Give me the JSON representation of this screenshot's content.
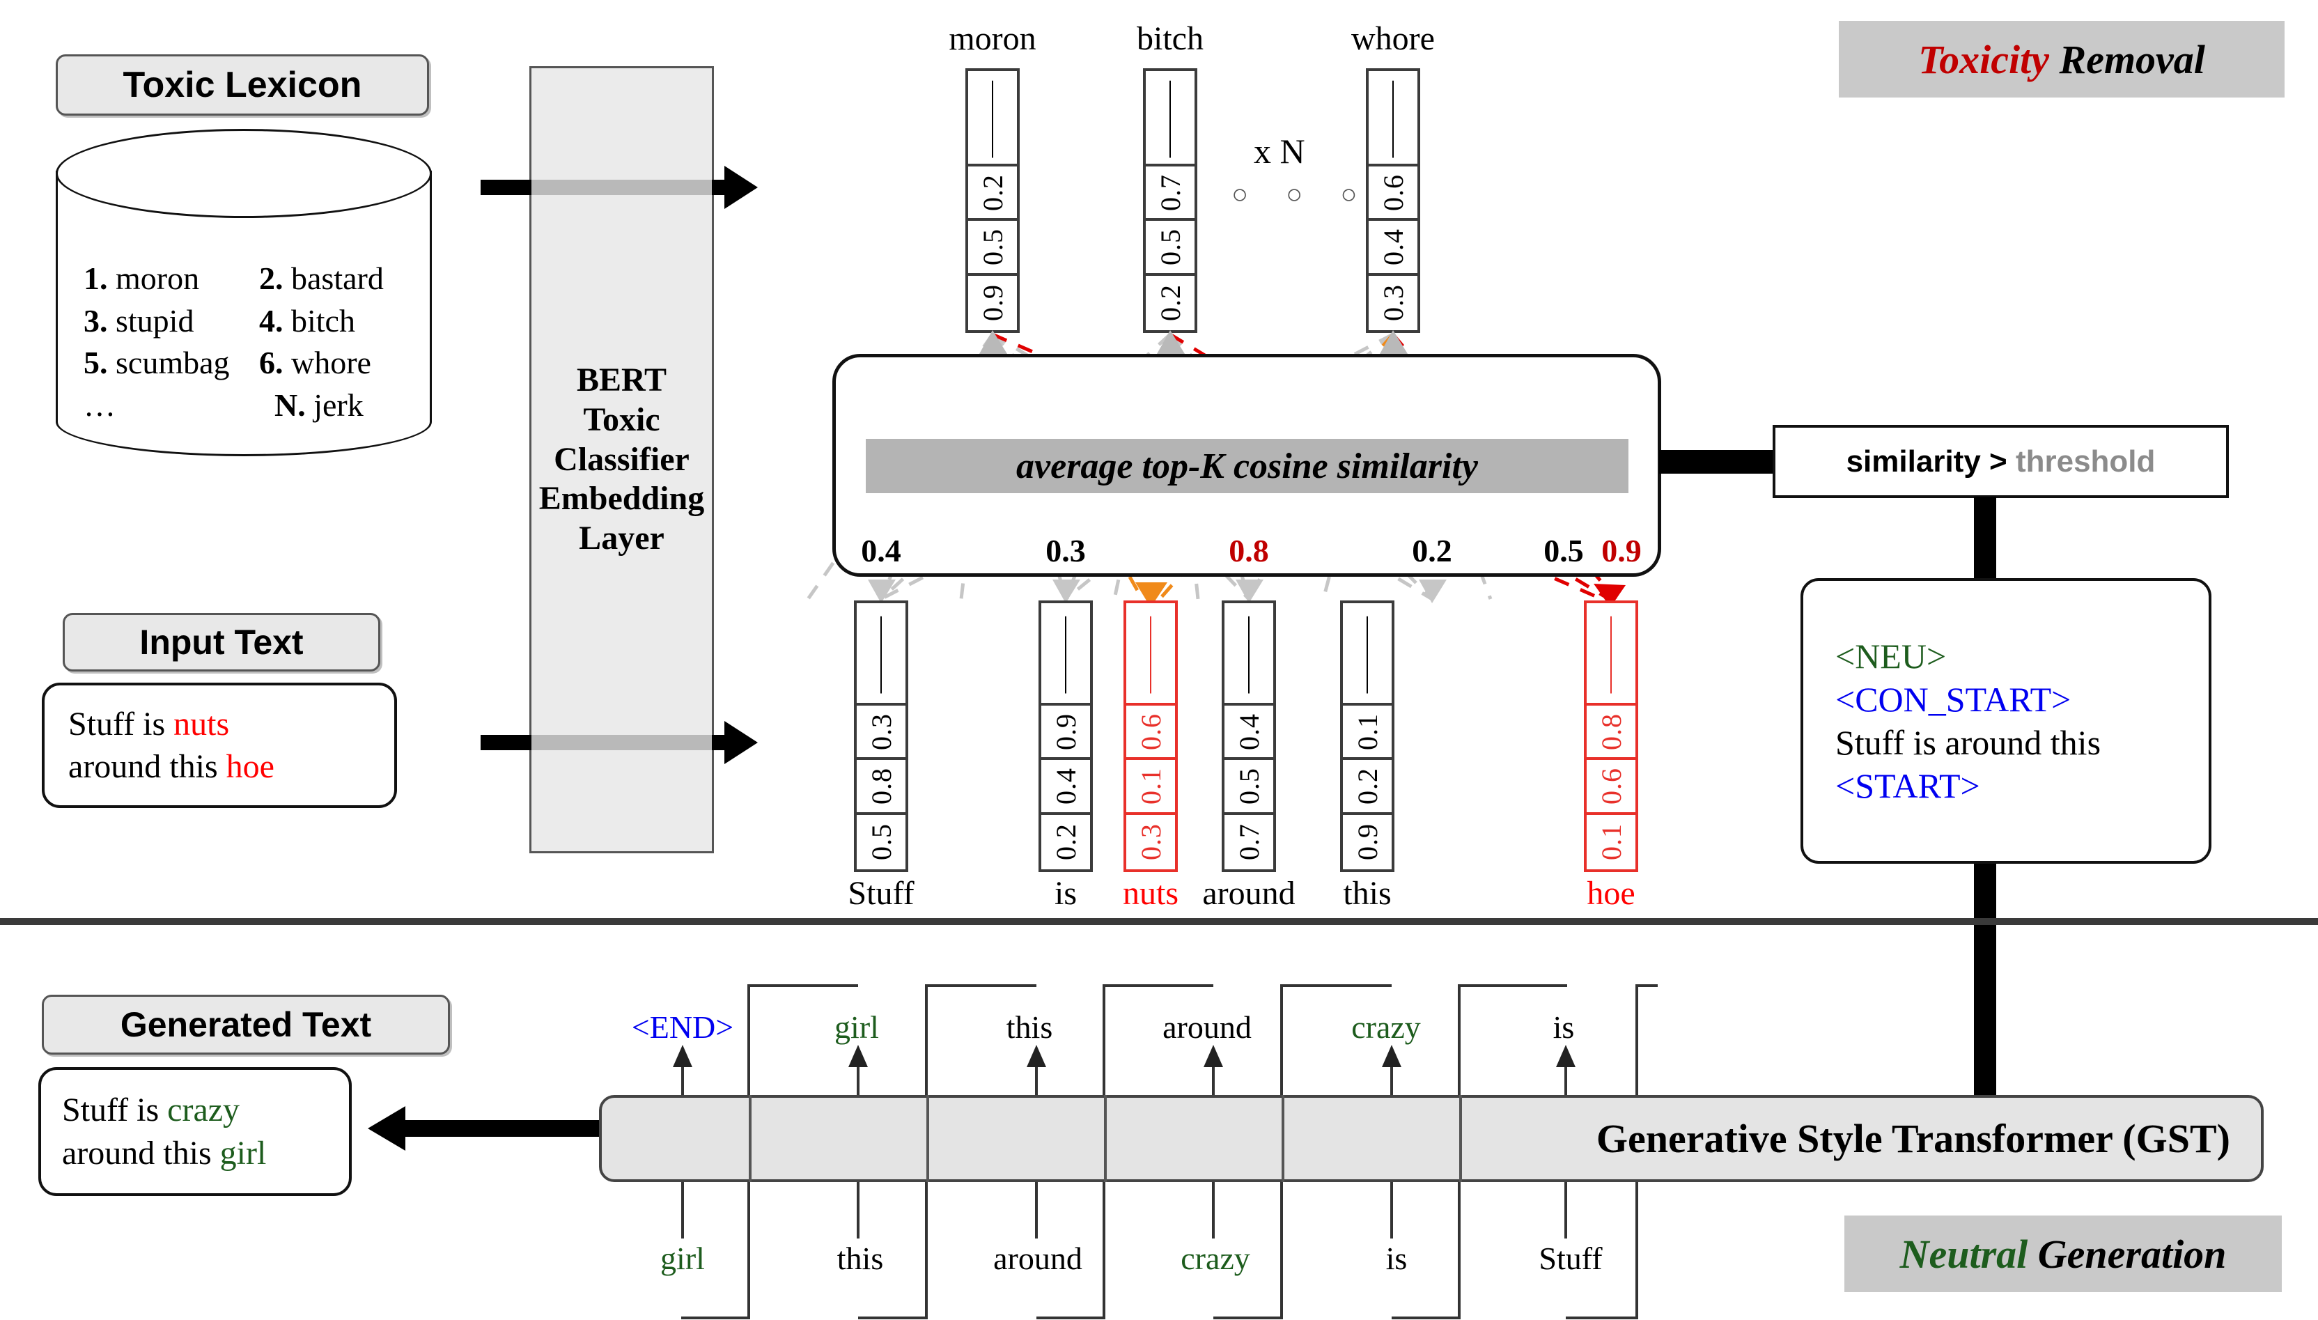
{
  "sections": {
    "toxicity_removal": "Toxicity Removal",
    "toxicity_removal_word1": "Toxicity",
    "toxicity_removal_word2": "Removal",
    "neutral_generation_word1": "Neutral",
    "neutral_generation_word2": "Generation"
  },
  "lexicon": {
    "title": "Toxic Lexicon",
    "entries_left": [
      "1. moron",
      "3. stupid",
      "5. scumbag",
      "…"
    ],
    "entries_right": [
      "2. bastard",
      "4. bitch",
      "6. whore",
      "N. jerk"
    ]
  },
  "input": {
    "title": "Input Text",
    "line1_plain": "Stuff is ",
    "line1_toxic": "nuts",
    "line2_plain": "around this ",
    "line2_toxic": "hoe"
  },
  "generated": {
    "title": "Generated Text",
    "line1_plain": "Stuff is ",
    "line1_neutral": "crazy",
    "line2_plain": "around this ",
    "line2_neutral": "girl"
  },
  "bert": {
    "lines": [
      "BERT",
      "Toxic",
      "Classifier",
      "Embedding",
      "Layer"
    ]
  },
  "repeat": {
    "label": "x N",
    "dots": "○ ○ ○"
  },
  "lexicon_vectors": [
    {
      "word": "moron",
      "dots": "—",
      "values": [
        "0.2",
        "0.5",
        "0.9"
      ]
    },
    {
      "word": "bitch",
      "dots": "—",
      "values": [
        "0.7",
        "0.5",
        "0.2"
      ]
    },
    {
      "word": "whore",
      "dots": "—",
      "values": [
        "0.6",
        "0.4",
        "0.3"
      ]
    }
  ],
  "input_vectors": [
    {
      "word": "Stuff",
      "toxic": false,
      "values": [
        "0.3",
        "0.8",
        "0.5"
      ]
    },
    {
      "word": "is",
      "toxic": false,
      "values": [
        "0.9",
        "0.4",
        "0.2"
      ]
    },
    {
      "word": "nuts",
      "toxic": true,
      "values": [
        "0.6",
        "0.1",
        "0.3"
      ]
    },
    {
      "word": "around",
      "toxic": false,
      "values": [
        "0.4",
        "0.5",
        "0.7"
      ]
    },
    {
      "word": "this",
      "toxic": false,
      "values": [
        "0.1",
        "0.2",
        "0.9"
      ]
    },
    {
      "word": "hoe",
      "toxic": true,
      "values": [
        "0.8",
        "0.6",
        "0.1"
      ]
    }
  ],
  "similarity": {
    "bar_label": "average top-K cosine similarity",
    "scores": [
      "0.4",
      "0.3",
      "0.8",
      "0.2",
      "0.5",
      "0.9"
    ],
    "high_flags": [
      false,
      false,
      true,
      false,
      false,
      true
    ]
  },
  "threshold": {
    "left": "similarity >",
    "right": "threshold"
  },
  "masked_prompt": {
    "neu": "<NEU>",
    "con_start": "<CON_START>",
    "content": "Stuff is around this",
    "start": "<START>"
  },
  "gst": {
    "label": "Generative Style Transformer (GST)",
    "outputs": [
      {
        "text": "<END>",
        "color": "blue"
      },
      {
        "text": "girl",
        "color": "green"
      },
      {
        "text": "this",
        "color": "black"
      },
      {
        "text": "around",
        "color": "black"
      },
      {
        "text": "crazy",
        "color": "green"
      },
      {
        "text": "is",
        "color": "black"
      }
    ],
    "inputs": [
      {
        "text": "girl",
        "color": "green"
      },
      {
        "text": "this",
        "color": "black"
      },
      {
        "text": "around",
        "color": "black"
      },
      {
        "text": "crazy",
        "color": "green"
      },
      {
        "text": "is",
        "color": "black"
      },
      {
        "text": "Stuff",
        "color": "black"
      }
    ]
  },
  "colors": {
    "toxic_red": "#ff0000",
    "score_red": "#c00000",
    "neutral_green": "#1d5c1d",
    "token_blue": "#0000f0",
    "panel_grey": "#b4b4b4",
    "tag_grey": "#e8e8e8",
    "link_grey": "#c6c6c6",
    "link_orange": "#f08a1a",
    "link_red": "#e00000"
  }
}
